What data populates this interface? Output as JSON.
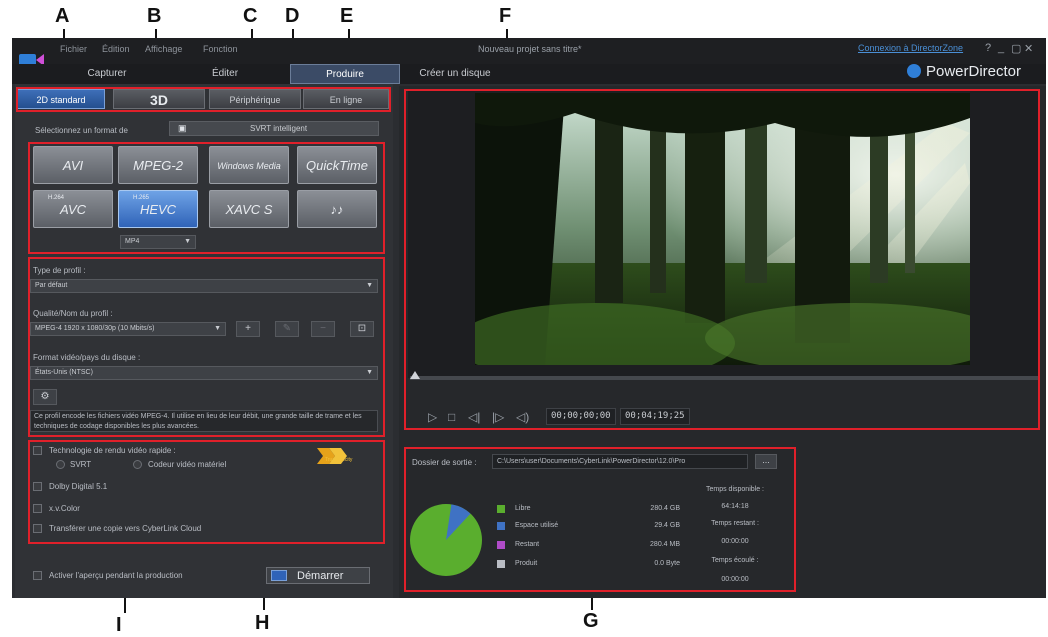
{
  "callouts": [
    "A",
    "B",
    "C",
    "D",
    "E",
    "F",
    "G",
    "H",
    "I"
  ],
  "menu": {
    "items": [
      "Fichier",
      "Édition",
      "Affichage",
      "Fonction"
    ],
    "window_title": "Nouveau projet sans titre*",
    "login": "Connexion à DirectorZone",
    "controls": [
      "?",
      "_",
      "▢",
      "✕"
    ]
  },
  "modes": {
    "tabs": [
      "Capturer",
      "Éditer",
      "Produire",
      "Créer un disque"
    ],
    "active": "Produire",
    "brand": "PowerDirector"
  },
  "format_tabs": [
    "2D standard",
    "3D",
    "Périphérique",
    "En ligne"
  ],
  "format": {
    "label": "Sélectionnez un format de",
    "selector": "SVRT intelligent",
    "buttons": [
      {
        "label": "AVI",
        "sup": ""
      },
      {
        "label": "MPEG-2",
        "sup": ""
      },
      {
        "label": "Windows Media",
        "sup": ""
      },
      {
        "label": "QuickTime",
        "sup": ""
      },
      {
        "label": "AVC",
        "sup": "H.264"
      },
      {
        "label": "HEVC",
        "sup": "H.265"
      },
      {
        "label": "XAVC S",
        "sup": ""
      },
      {
        "label": "♪♪",
        "sup": ""
      }
    ],
    "container": "MP4"
  },
  "profile": {
    "type_label": "Type de profil :",
    "type_value": "Par défaut",
    "quality_label": "Qualité/Nom du profil :",
    "quality_value": "MPEG-4 1920 x 1080/30p (10 Mbits/s)",
    "country_label": "Format vidéo/pays du disque :",
    "country_value": "États-Unis (NTSC)",
    "description": "Ce profil encode les fichiers vidéo MPEG-4. Il utilise en lieu de leur débit, une grande taille de trame et les techniques de codage disponibles les plus avancées."
  },
  "options": {
    "tech_label": "Technologie de rendu vidéo rapide :",
    "svrt": "SVRT",
    "hw": "Codeur vidéo matériel",
    "badge": "TrueVelocity",
    "dolby": "Dolby Digital 5.1",
    "xvcolor": "x.v.Color",
    "upload": "Transférer une copie vers CyberLink Cloud"
  },
  "bottom": {
    "preview_checkbox": "Activer l'aperçu pendant la production",
    "start": "Démarrer"
  },
  "player": {
    "timecode_current": "00;00;00;00",
    "timecode_total": "00;04;19;25"
  },
  "output": {
    "label": "Dossier de sortie :",
    "path": "C:\\Users\\user\\Documents\\CyberLink\\PowerDirector\\12.0\\Pro",
    "browse": "...",
    "legend": [
      {
        "label": "Libre",
        "value": "280.4 GB",
        "color": "#5aae2e"
      },
      {
        "label": "Espace utilisé",
        "value": "29.4 GB",
        "color": "#3f72c4"
      },
      {
        "label": "Restant",
        "value": "280.4 MB",
        "color": "#b04cc8"
      },
      {
        "label": "Produit",
        "value": "0.0 Byte",
        "color": "#b9bdc4"
      }
    ],
    "disk_usage_pie": {
      "free_fraction": 0.905,
      "used_fraction": 0.095
    },
    "times": [
      {
        "label": "Temps disponible :",
        "value": "64:14:18"
      },
      {
        "label": "Temps restant :",
        "value": "00:00:00"
      },
      {
        "label": "Temps écoulé :",
        "value": "00:00:00"
      }
    ]
  }
}
